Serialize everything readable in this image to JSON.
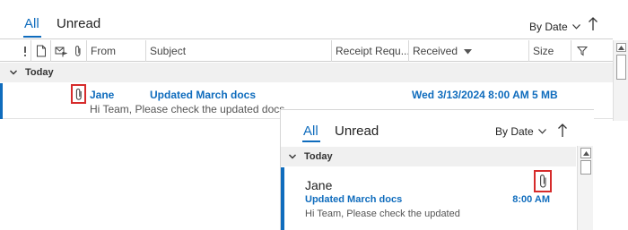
{
  "list": {
    "tabs": {
      "all": "All",
      "unread": "Unread"
    },
    "sort": {
      "label": "By Date"
    },
    "columns": {
      "from": "From",
      "subject": "Subject",
      "receipt": "Receipt Requ...",
      "received": "Received",
      "size": "Size"
    },
    "group": {
      "label": "Today"
    },
    "message": {
      "from": "Jane",
      "subject": "Updated March docs",
      "received": "Wed 3/13/2024 8:00 AM",
      "size": "5 MB",
      "preview": "Hi Team,  Please check the updated docs"
    }
  },
  "compact": {
    "tabs": {
      "all": "All",
      "unread": "Unread"
    },
    "sort": {
      "label": "By Date"
    },
    "group": {
      "label": "Today"
    },
    "message": {
      "from": "Jane",
      "subject": "Updated March docs",
      "time": "8:00 AM",
      "preview": "Hi Team,  Please check the updated"
    }
  },
  "icons": {
    "importance": "exclamation-icon",
    "document": "document-icon",
    "reminder": "envelope-flag-icon",
    "attachment": "paperclip-icon",
    "filter": "filter-icon",
    "sort_direction": "arrow-up-icon"
  },
  "colors": {
    "accent": "#0f6cbd",
    "highlight_box": "#d62b2b",
    "group_background": "#f0f0f0"
  }
}
